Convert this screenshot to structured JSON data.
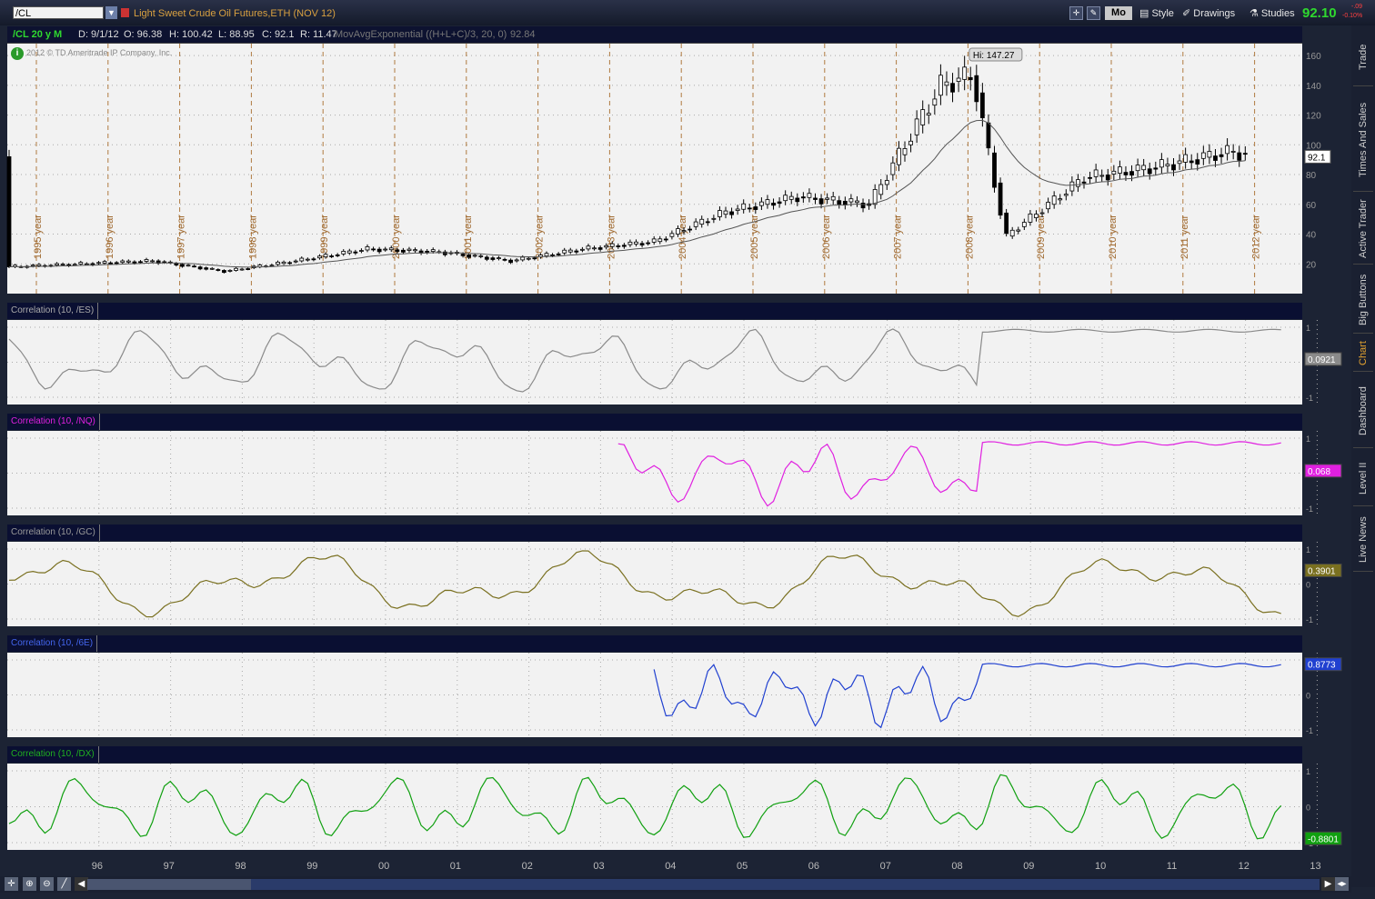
{
  "toolbar": {
    "symbol": "/CL",
    "description": "Light Sweet Crude Oil Futures,ETH (NOV 12)",
    "mo_label": "Mo",
    "style_label": "Style",
    "drawings_label": "Drawings",
    "studies_label": "Studies",
    "last_price": "92.10",
    "change_top": "-.09",
    "change_pct": "-0.10%"
  },
  "info_bar": {
    "symbol_period": "/CL 20 y M",
    "date": "D: 9/1/12",
    "open": "O: 96.38",
    "high": "H: 100.42",
    "low": "L: 88.95",
    "close": "C: 92.1",
    "range": "R: 11.47",
    "study": "MovAvgExponential ((H+L+C)/3, 20, 0)",
    "study_value": "92.84"
  },
  "copyright": "2012 © TD Ameritrade IP Company, Inc.",
  "price_chart": {
    "high_label": "Hi: 147.27",
    "current_label": "92.1",
    "y_ticks": [
      "160",
      "140",
      "120",
      "100",
      "80",
      "60",
      "40",
      "20"
    ],
    "year_labels": [
      "1995 year",
      "1996 year",
      "1997 year",
      "1998 year",
      "1999 year",
      "2000 year",
      "2001 year",
      "2002 year",
      "2003 year",
      "2004 year",
      "2005 year",
      "2006 year",
      "2007 year",
      "2008 year",
      "2009 year",
      "2010 year",
      "2011 year",
      "2012 year"
    ]
  },
  "chart_data": [
    {
      "type": "candlestick",
      "title": "/CL monthly",
      "x": [
        1995,
        1996,
        1997,
        1998,
        1999,
        2000,
        2001,
        2002,
        2003,
        2004,
        2005,
        2006,
        2007,
        2008,
        2009,
        2010,
        2011,
        2012
      ],
      "close": [
        18,
        20,
        22,
        15,
        22,
        30,
        28,
        22,
        30,
        35,
        55,
        65,
        60,
        140,
        42,
        78,
        85,
        95
      ],
      "ylim": [
        0,
        160
      ],
      "ma": "MovAvgExponential",
      "ma_value": 92.84
    },
    {
      "type": "line",
      "title": "Correlation (10, /ES)",
      "value": "0.0921",
      "color": "#8a8a8a",
      "ylim": [
        -1,
        1
      ],
      "start": 1995,
      "end": 2012.8
    },
    {
      "type": "line",
      "title": "Correlation (10, /NQ)",
      "value": "0.068",
      "color": "#e020e0",
      "ylim": [
        -1,
        1
      ],
      "start": 2003.5,
      "end": 2012.8
    },
    {
      "type": "line",
      "title": "Correlation (10, /GC)",
      "value": "0.3901",
      "color": "#7a7020",
      "ylim": [
        -1,
        1
      ],
      "start": 1995,
      "end": 2012.8
    },
    {
      "type": "line",
      "title": "Correlation (10, /6E)",
      "value": "0.8773",
      "color": "#2040d0",
      "ylim": [
        -1,
        1
      ],
      "start": 2004,
      "end": 2012.8
    },
    {
      "type": "line",
      "title": "Correlation (10, /DX)",
      "value": "-0.8801",
      "color": "#10a010",
      "ylim": [
        -1,
        1
      ],
      "start": 1995,
      "end": 2012.8
    }
  ],
  "sub_ticks": [
    "1",
    "0",
    "-1"
  ],
  "x_axis": [
    "96",
    "97",
    "98",
    "99",
    "00",
    "01",
    "02",
    "03",
    "04",
    "05",
    "06",
    "07",
    "08",
    "09",
    "10",
    "11",
    "12",
    "13"
  ],
  "sidebar": [
    "Trade",
    "Times And Sales",
    "Active Trader",
    "Big Buttons",
    "Chart",
    "Dashboard",
    "Level II",
    "Live News"
  ],
  "colors": {
    "accent": "#e0a030",
    "background": "#1c2334",
    "panel": "#f2f2f2"
  }
}
